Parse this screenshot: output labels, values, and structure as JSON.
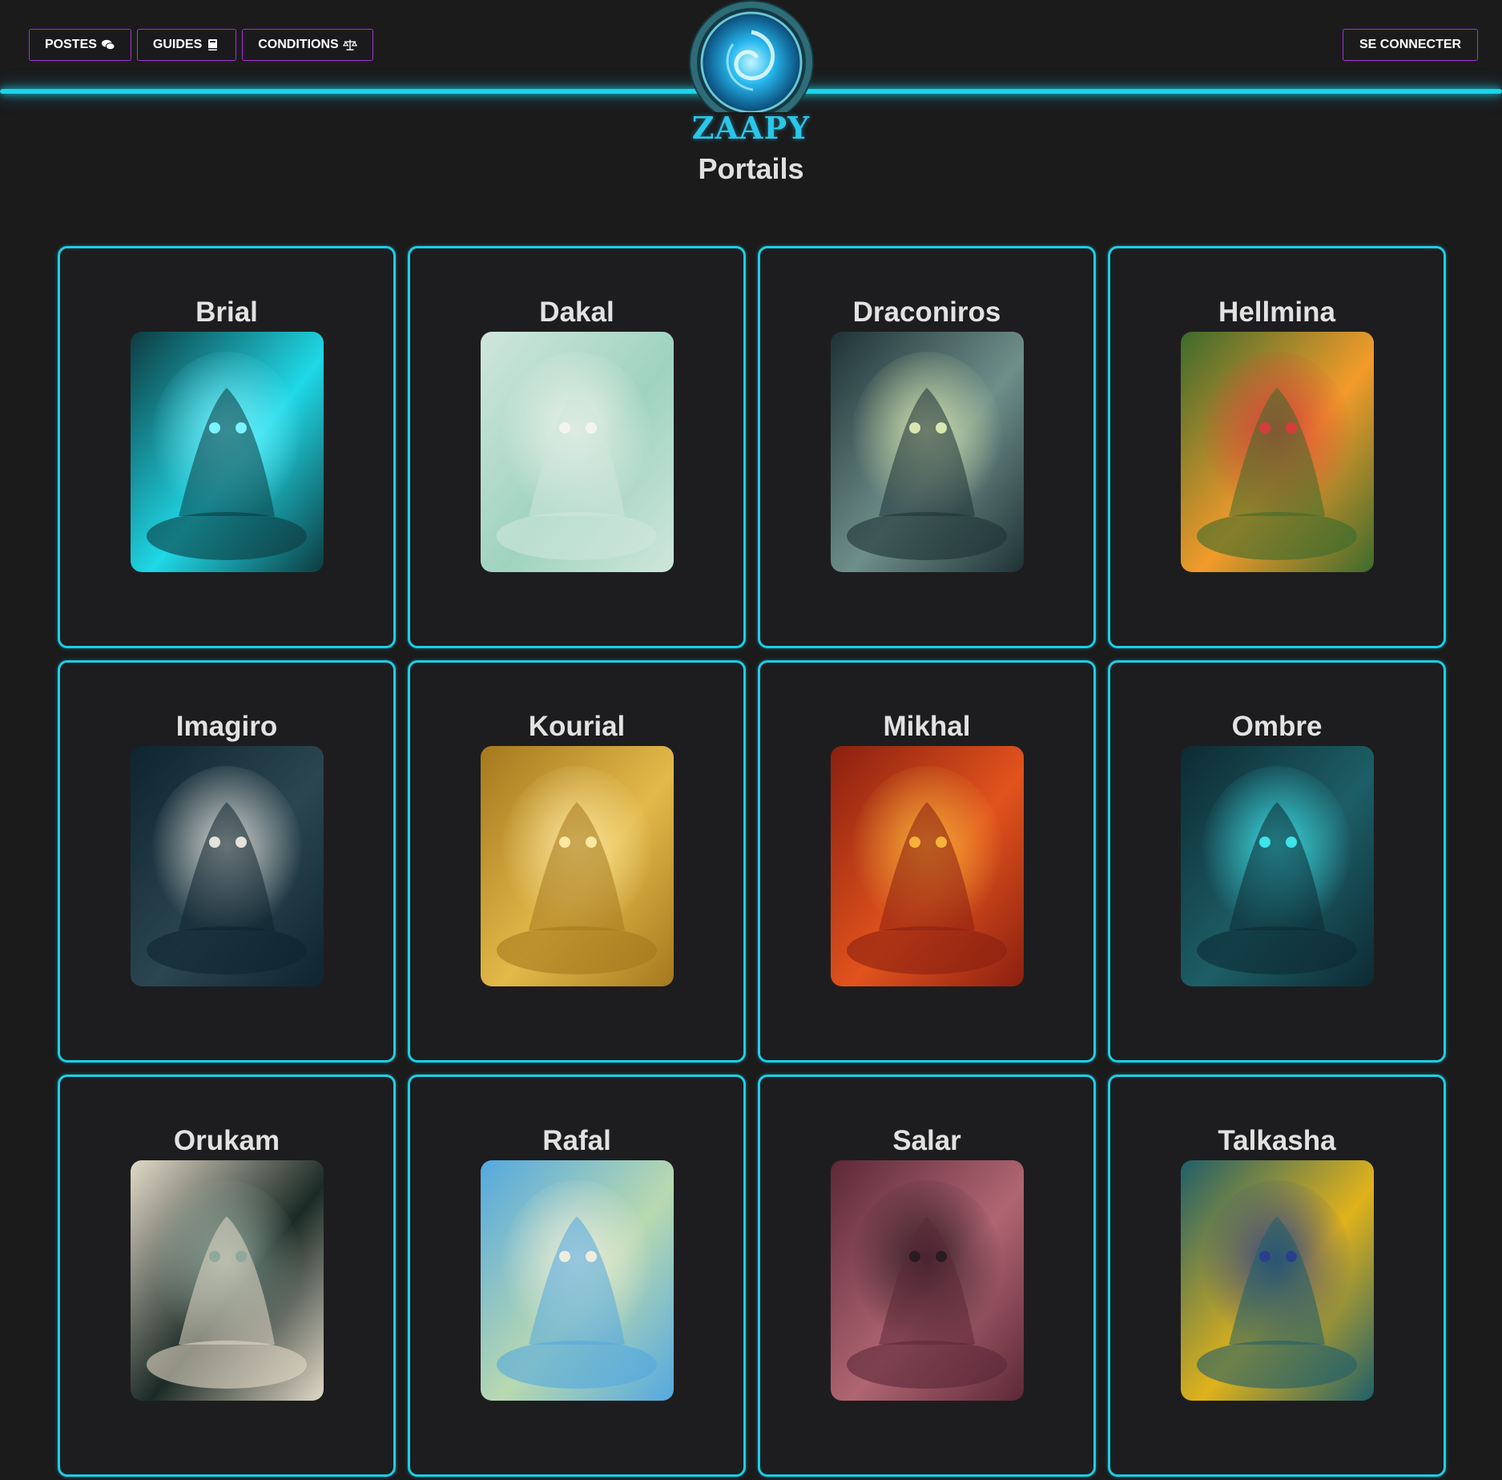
{
  "nav": {
    "items": [
      {
        "label": "POSTES",
        "icon": "comments-icon"
      },
      {
        "label": "GUIDES",
        "icon": "book-icon"
      },
      {
        "label": "CONDITIONS",
        "icon": "scale-icon"
      }
    ],
    "login_label": "SE CONNECTER"
  },
  "brand": {
    "name": "ZAAPY",
    "logo_icon": "portal-swirl-icon",
    "accent": "#19d4ea",
    "button_border": "#a035d4"
  },
  "page": {
    "title": "Portails"
  },
  "portals": [
    {
      "name": "Brial",
      "palette": [
        "#0d3b40",
        "#1fd8e6",
        "#7af3ff"
      ]
    },
    {
      "name": "Dakal",
      "palette": [
        "#cfe6dc",
        "#9fd3c0",
        "#f4f4ee"
      ]
    },
    {
      "name": "Draconiros",
      "palette": [
        "#1e3236",
        "#6f8f8a",
        "#d9e6b0"
      ]
    },
    {
      "name": "Hellmina",
      "palette": [
        "#3c6b2d",
        "#f39b2a",
        "#d63c3c"
      ]
    },
    {
      "name": "Imagiro",
      "palette": [
        "#0e2430",
        "#2b4650",
        "#e4e2dc"
      ]
    },
    {
      "name": "Kourial",
      "palette": [
        "#a5781d",
        "#e3b94a",
        "#fbe7a0"
      ]
    },
    {
      "name": "Mikhal",
      "palette": [
        "#8a1f10",
        "#e2531d",
        "#f6b23a"
      ]
    },
    {
      "name": "Ombre",
      "palette": [
        "#0d2a33",
        "#1d5e66",
        "#3fe3ea"
      ]
    },
    {
      "name": "Orukam",
      "palette": [
        "#e2d9c7",
        "#1b2a26",
        "#8fa89c"
      ]
    },
    {
      "name": "Rafal",
      "palette": [
        "#54a8e0",
        "#b9d9b0",
        "#eeeedd"
      ]
    },
    {
      "name": "Salar",
      "palette": [
        "#5c2838",
        "#b06672",
        "#2a1a22"
      ]
    },
    {
      "name": "Talkasha",
      "palette": [
        "#1f5f6a",
        "#e0b21b",
        "#2a3f8c"
      ]
    }
  ]
}
